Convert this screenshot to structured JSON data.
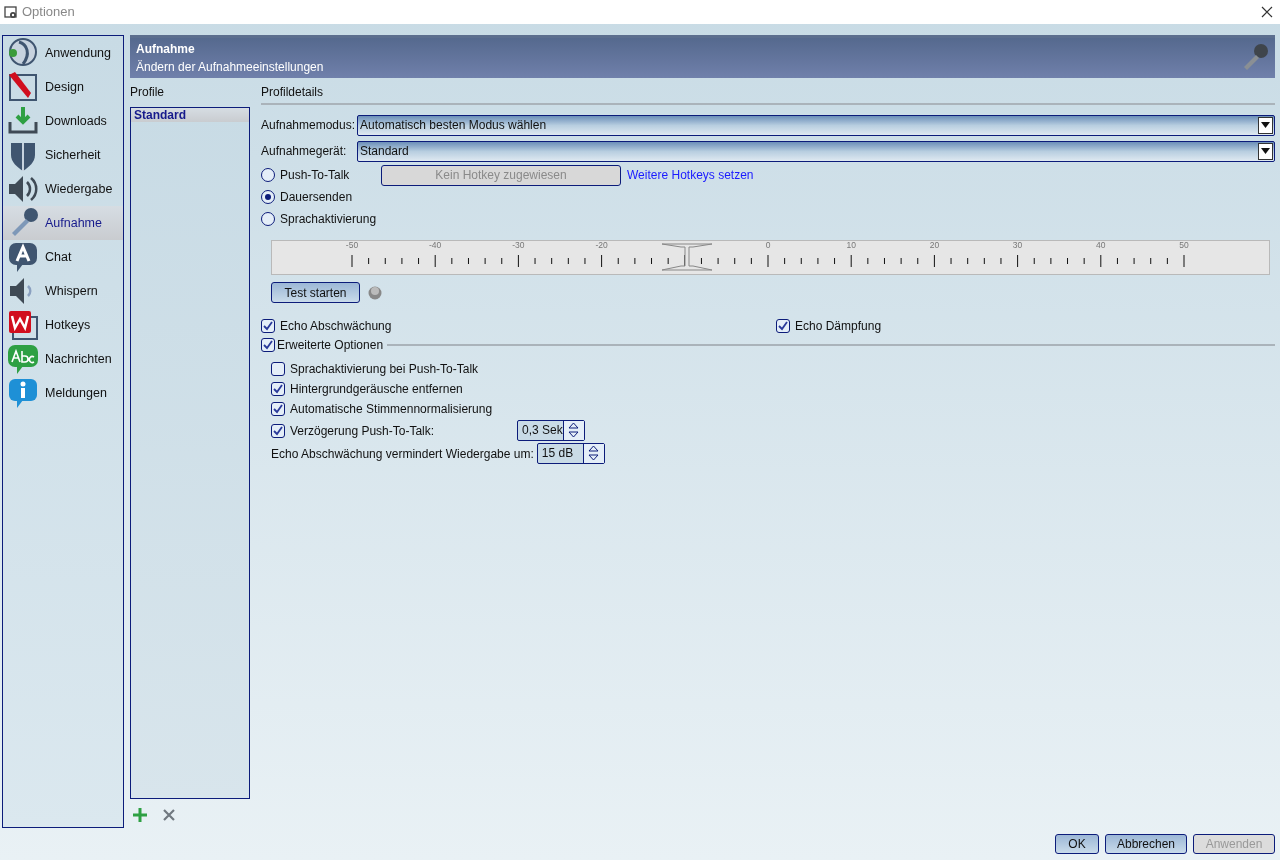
{
  "window": {
    "title": "Optionen"
  },
  "nav": [
    {
      "label": "Anwendung",
      "selected": false
    },
    {
      "label": "Design",
      "selected": false
    },
    {
      "label": "Downloads",
      "selected": false
    },
    {
      "label": "Sicherheit",
      "selected": false
    },
    {
      "label": "Wiedergabe",
      "selected": false
    },
    {
      "label": "Aufnahme",
      "selected": true
    },
    {
      "label": "Chat",
      "selected": false
    },
    {
      "label": "Whispern",
      "selected": false
    },
    {
      "label": "Hotkeys",
      "selected": false
    },
    {
      "label": "Nachrichten",
      "selected": false
    },
    {
      "label": "Meldungen",
      "selected": false
    }
  ],
  "header": {
    "title": "Aufnahme",
    "subtitle": "Ändern der Aufnahmeeinstellungen"
  },
  "profiles": {
    "heading": "Profile",
    "items": [
      {
        "label": "Standard",
        "selected": true
      }
    ]
  },
  "details": {
    "heading": "Profildetails",
    "dropdowns": [
      {
        "label": "Aufnahmemodus:",
        "value": "Automatisch besten Modus wählen"
      },
      {
        "label": "Aufnahmegerät:",
        "value": "Standard"
      }
    ],
    "modes": [
      {
        "label": "Push-To-Talk",
        "selected": false
      },
      {
        "label": "Dauersenden",
        "selected": true
      },
      {
        "label": "Sprachaktivierung",
        "selected": false
      }
    ],
    "hotkey_button": "Kein Hotkey zugewiesen",
    "hotkeys_link": "Weitere Hotkeys setzen",
    "scale": {
      "ticks": [
        "-50",
        "-40",
        "-30",
        "-20",
        "0",
        "10",
        "20",
        "30",
        "40",
        "50"
      ],
      "level": 0.416
    },
    "test_button": "Test starten",
    "echo": [
      {
        "label": "Echo Abschwächung",
        "checked": true
      },
      {
        "label": "Echo Dämpfung",
        "checked": true
      }
    ],
    "advanced": {
      "label": "Erweiterte Optionen",
      "checked": true,
      "options": [
        {
          "kind": "checkbox",
          "label": "Sprachaktivierung bei Push-To-Talk",
          "checked": false
        },
        {
          "kind": "checkbox",
          "label": "Hintergrundgeräusche entfernen",
          "checked": true
        },
        {
          "kind": "checkbox",
          "label": "Automatische Stimmennormalisierung",
          "checked": true
        },
        {
          "kind": "spin",
          "label": "Verzögerung Push-To-Talk:",
          "checked": true,
          "value": "0,3 Sek"
        },
        {
          "kind": "spinonly",
          "label": "Echo Abschwächung vermindert Wiedergabe um:",
          "value": "15 dB"
        }
      ]
    }
  },
  "buttons": [
    {
      "label": "OK",
      "disabled": false
    },
    {
      "label": "Abbrechen",
      "disabled": false
    },
    {
      "label": "Anwenden",
      "disabled": true
    }
  ]
}
